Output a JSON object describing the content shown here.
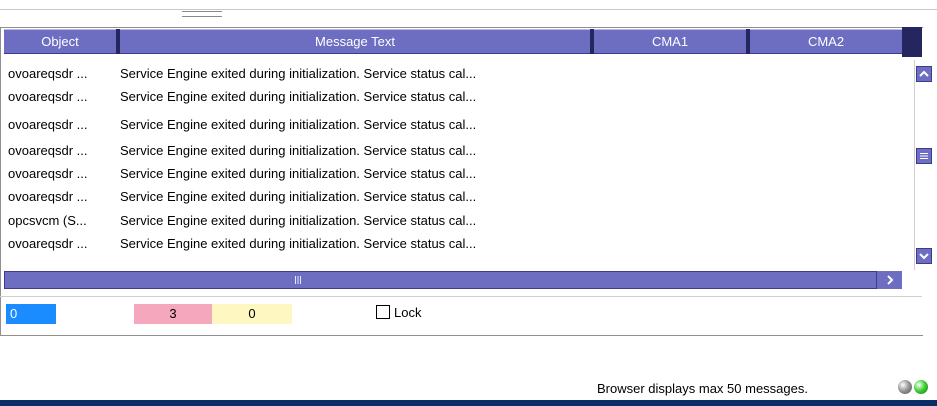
{
  "table": {
    "columns": [
      {
        "label": "Object"
      },
      {
        "label": "Message Text"
      },
      {
        "label": "CMA1"
      },
      {
        "label": "CMA2"
      }
    ],
    "rows": [
      {
        "object": "ovoareqsdr ...",
        "message": "Service Engine exited during initialization. Service status cal..."
      },
      {
        "object": "ovoareqsdr ...",
        "message": "Service Engine exited during initialization. Service status cal..."
      },
      {
        "object": "ovoareqsdr ...",
        "message": "Service Engine exited during initialization. Service status cal..."
      },
      {
        "object": "ovoareqsdr ...",
        "message": "Service Engine exited during initialization. Service status cal..."
      },
      {
        "object": "ovoareqsdr ...",
        "message": "Service Engine exited during initialization. Service status cal..."
      },
      {
        "object": "ovoareqsdr ...",
        "message": "Service Engine exited during initialization. Service status cal..."
      },
      {
        "object": "opcsvcm (S...",
        "message": "Service Engine exited during initialization. Service status cal..."
      },
      {
        "object": "ovoareqsdr ...",
        "message": "Service Engine exited during initialization. Service status cal..."
      }
    ]
  },
  "status": {
    "count_blue": "0",
    "count_pink": "3",
    "count_yellow": "0",
    "lock_label": "Lock",
    "lock_checked": false
  },
  "footer": {
    "text": "Browser displays max 50 messages."
  },
  "icons": {
    "scroll_up": "chevron-up-icon",
    "scroll_thumb": "scroll-grip-icon",
    "scroll_down": "chevron-down-icon",
    "scroll_right": "chevron-right-icon",
    "status_gray": "gray-status-light-icon",
    "status_green": "green-status-light-icon"
  },
  "colors": {
    "header": "#6d6dc2",
    "header_separator": "#25255f",
    "count_blue": "#1a8cff",
    "count_pink": "#f4a7bd",
    "count_yellow": "#fff7c2",
    "bottom_bar": "#0b2d66"
  }
}
